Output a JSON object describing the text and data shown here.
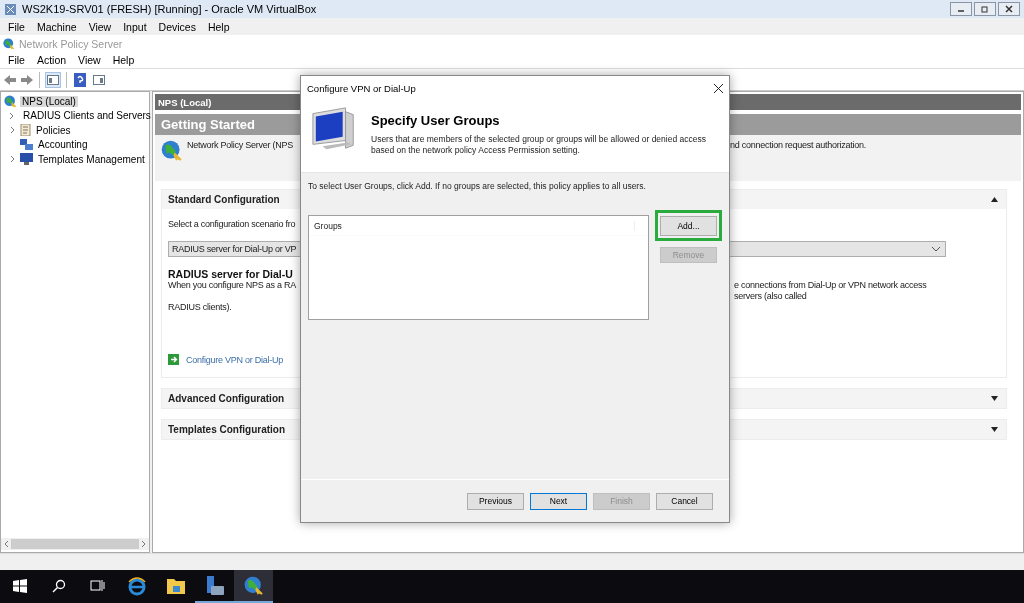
{
  "host_window": {
    "title": "WS2K19-SRV01 (FRESH) [Running] - Oracle VM VirtualBox",
    "menu": [
      "File",
      "Machine",
      "View",
      "Input",
      "Devices",
      "Help"
    ]
  },
  "app": {
    "title": "Network Policy Server",
    "menu": [
      "File",
      "Action",
      "View",
      "Help"
    ]
  },
  "tree": {
    "items": [
      {
        "label": "NPS (Local)",
        "selected": true,
        "children": [
          {
            "label": "RADIUS Clients and Servers",
            "selected": false,
            "expandable": true
          },
          {
            "label": "Policies",
            "selected": false,
            "expandable": true
          },
          {
            "label": "Accounting",
            "selected": false,
            "expandable": false
          },
          {
            "label": "Templates Management",
            "selected": false,
            "expandable": true
          }
        ]
      }
    ]
  },
  "content": {
    "header": "NPS (Local)",
    "banner": "Getting Started",
    "intro_start": "Network Policy Server (NPS",
    "intro_end": "nd connection request authorization.",
    "sections": [
      {
        "title": "Standard Configuration",
        "expanded": true,
        "prompt": "Select a configuration scenario fro",
        "scenario": "RADIUS server for Dial-Up or VP",
        "scenario_title": "RADIUS server for Dial-U",
        "description_start": "When you configure NPS as a RA",
        "description_end": "e connections from Dial-Up or VPN network access servers (also called",
        "description_last": "RADIUS clients).",
        "link": "Configure VPN or Dial-Up"
      },
      {
        "title": "Advanced Configuration",
        "expanded": false
      },
      {
        "title": "Templates Configuration",
        "expanded": false
      }
    ]
  },
  "dialog": {
    "title": "Configure VPN or Dial-Up",
    "heading": "Specify User Groups",
    "description": "Users that are members of the selected group or groups will be allowed or denied access based on the network policy Access Permission setting.",
    "instruction": "To select User Groups, click Add. If no groups are selected, this policy applies to all users.",
    "list": {
      "columns": [
        "Groups"
      ]
    },
    "side_buttons": [
      {
        "label": "Add...",
        "disabled": false,
        "highlighted": true
      },
      {
        "label": "Remove",
        "disabled": true,
        "highlighted": false
      }
    ],
    "buttons": [
      {
        "label": "Previous",
        "disabled": false,
        "focused": false
      },
      {
        "label": "Next",
        "disabled": false,
        "focused": true
      },
      {
        "label": "Finish",
        "disabled": true,
        "focused": false
      },
      {
        "label": "Cancel",
        "disabled": false,
        "focused": false
      }
    ]
  },
  "taskbar": {
    "apps": [
      {
        "running": false,
        "selected": false
      },
      {
        "running": false,
        "selected": false
      },
      {
        "running": true,
        "selected": false
      },
      {
        "running": true,
        "selected": true
      }
    ]
  }
}
